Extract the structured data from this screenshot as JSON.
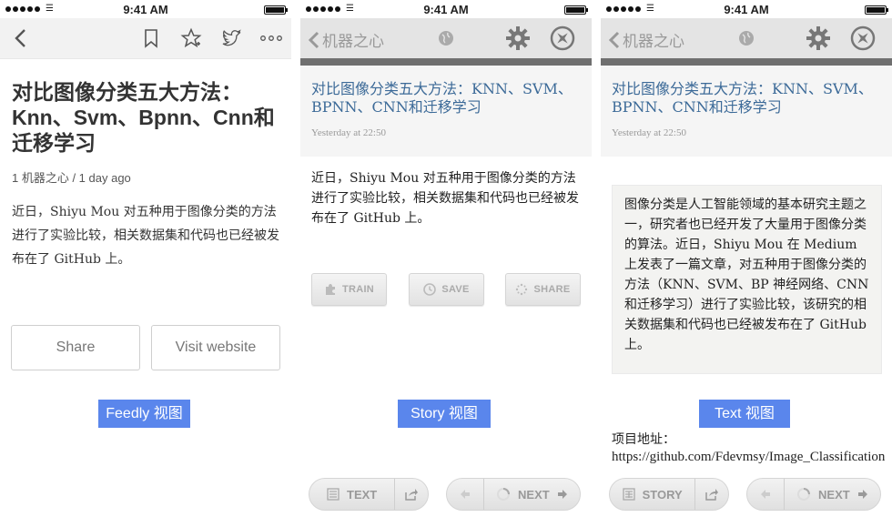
{
  "status_bar": {
    "time": "9:41 AM"
  },
  "feedly": {
    "title": "对比图像分类五大方法：Knn、Svm、Bpnn、Cnn和迁移学习",
    "meta": "1 机器之心 / 1 day ago",
    "body": "近日，Shiyu Mou 对五种用于图像分类的方法进行了实验比较，相关数据集和代码也已经被发布在了 GitHub 上。",
    "share_label": "Share",
    "visit_label": "Visit website",
    "view_tag": "Feedly 视图",
    "icons": [
      "back-icon",
      "bookmark-icon",
      "star-icon",
      "twitter-icon",
      "more-icon"
    ]
  },
  "story": {
    "back_label": "机器之心",
    "title": "对比图像分类五大方法：KNN、SVM、BPNN、CNN和迁移学习",
    "date": "Yesterday at 22:50",
    "body": "近日，Shiyu Mou 对五种用于图像分类的方法进行了实验比较，相关数据集和代码也已经被发布在了 GitHub 上。",
    "train_label": "TRAIN",
    "save_label": "SAVE",
    "share_label": "SHARE",
    "view_tag": "Story 视图",
    "bottom_left_label": "TEXT",
    "next_label": "NEXT"
  },
  "text": {
    "back_label": "机器之心",
    "title": "对比图像分类五大方法：KNN、SVM、BPNN、CNN和迁移学习",
    "date": "Yesterday at 22:50",
    "body": "图像分类是人工智能领域的基本研究主题之一，研究者也已经开发了大量用于图像分类的算法。近日，Shiyu Mou 在 Medium 上发表了一篇文章，对五种用于图像分类的方法（KNN、SVM、BP 神经网络、CNN 和迁移学习）进行了实验比较，该研究的相关数据集和代码也已经被发布在了 GitHub 上。",
    "view_tag": "Text 视图",
    "project_label": "项目地址：",
    "project_url": "https://github.com/Fdevmsy/Image_Classification",
    "bottom_left_label": "STORY",
    "next_label": "NEXT"
  }
}
